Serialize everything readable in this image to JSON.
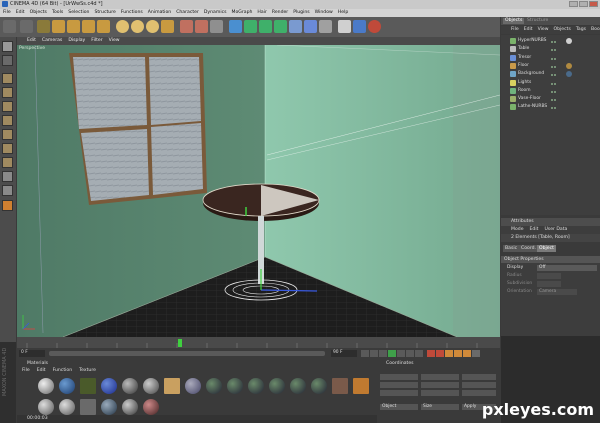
{
  "window": {
    "title": "CINEMA 4D (64 Bit) - [UrWwSs.c4d *]"
  },
  "menubar": [
    "File",
    "Edit",
    "Objects",
    "Tools",
    "Selection",
    "Structure",
    "Functions",
    "Animation",
    "Character",
    "Dynamics",
    "MoGraph",
    "Hair",
    "Render",
    "Plugins",
    "Window",
    "Help"
  ],
  "viewport": {
    "menu": [
      "Edit",
      "Cameras",
      "Display",
      "Filter",
      "View"
    ],
    "label": "Perspective"
  },
  "object_manager": {
    "tabs": [
      "Objects",
      "Structure"
    ],
    "menu": [
      "File",
      "Edit",
      "View",
      "Objects",
      "Tags",
      "Bookmarks"
    ],
    "objects": [
      {
        "name": "HyperNURBS",
        "color": "#7bb36b"
      },
      {
        "name": "Table",
        "color": "#bcbcbc"
      },
      {
        "name": "Tresor",
        "color": "#6a8fd6"
      },
      {
        "name": "Floor",
        "color": "#c99a4a"
      },
      {
        "name": "Background",
        "color": "#6fa5c8"
      },
      {
        "name": "Lights",
        "color": "#d8d060"
      },
      {
        "name": "Room",
        "color": "#6fb37d"
      },
      {
        "name": "Vase-Floor",
        "color": "#9bb06a"
      },
      {
        "name": "Lathe-NURBS",
        "color": "#7bb36b"
      }
    ]
  },
  "attributes_manager": {
    "title": "Attributes",
    "menu": [
      "Mode",
      "Edit",
      "User Data"
    ],
    "selection": "2 Elements [Table, Room]",
    "tabs": [
      "Basic",
      "Coord.",
      "Object"
    ],
    "section": "Object Properties",
    "props": [
      {
        "label": "Display",
        "value": "Off"
      },
      {
        "label": "Radius",
        "value": ""
      },
      {
        "label": "Subdivision",
        "value": ""
      },
      {
        "label": "Orientation",
        "value": "Camera"
      }
    ]
  },
  "timeline": {
    "start_frame": "0 F",
    "end_frame": "90 F",
    "current": "0 F"
  },
  "material_manager": {
    "title": "Materials",
    "menu": [
      "File",
      "Edit",
      "Function",
      "Texture"
    ]
  },
  "coordinates_manager": {
    "title": "Coordinates",
    "dropdown_left": "Object",
    "dropdown_right": "Size",
    "apply_label": "Apply"
  },
  "status": {
    "time": "00:00:03"
  },
  "watermark": "pxleyes.com",
  "side_logo": "MAXON CINEMA 4D"
}
